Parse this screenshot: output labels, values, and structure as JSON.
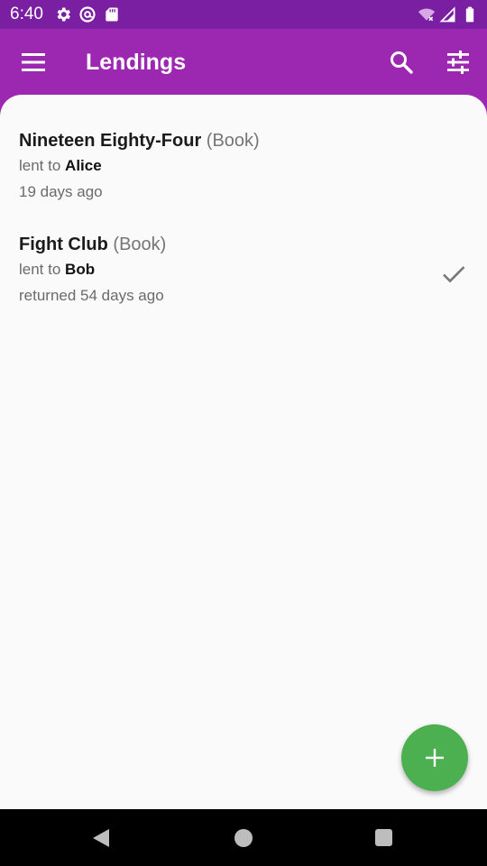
{
  "status_bar": {
    "time": "6:40",
    "left_icons": [
      "gear-icon",
      "at-sign-icon",
      "sd-card-icon"
    ],
    "right_icons": [
      "wifi-off-icon",
      "signal-icon",
      "battery-icon"
    ]
  },
  "app_bar": {
    "title": "Lendings",
    "menu_icon": "hamburger-menu-icon",
    "search_icon": "search-icon",
    "filter_icon": "tune-sliders-icon"
  },
  "lendings": [
    {
      "name": "Nineteen Eighty-Four",
      "kind": "(Book)",
      "lent_prefix": "lent to",
      "person": "Alice",
      "date": "19 days ago",
      "returned": false
    },
    {
      "name": "Fight Club",
      "kind": "(Book)",
      "lent_prefix": "lent to",
      "person": "Bob",
      "date": "returned 54 days ago",
      "returned": true
    }
  ],
  "fab": {
    "icon": "plus-icon",
    "color": "#4caf50"
  },
  "nav_bar": {
    "icons": [
      "back-triangle-icon",
      "home-circle-icon",
      "recents-square-icon"
    ]
  },
  "colors": {
    "status_bar": "#7b1fa2",
    "app_bar": "#9c27b0",
    "background": "#fafafa",
    "fab": "#4caf50"
  }
}
